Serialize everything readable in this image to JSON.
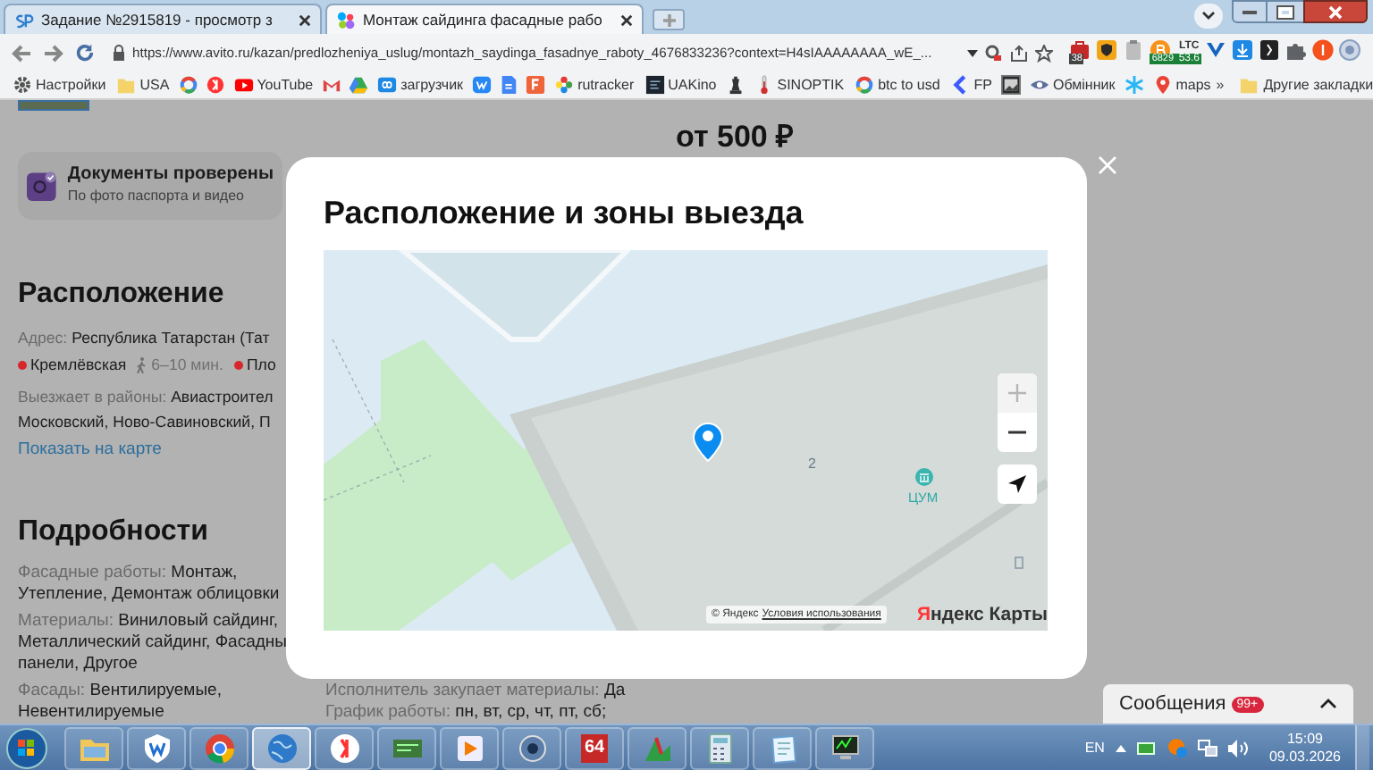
{
  "browser": {
    "tabs": [
      {
        "title": "Задание №2915819 - просмотр з",
        "kind": "sp",
        "selected": false
      },
      {
        "title": "Монтаж сайдинга фасадные рабо",
        "kind": "dots",
        "selected": true
      }
    ],
    "url": "https://www.avito.ru/kazan/predlozheniya_uslug/montazh_saydinga_fasadnye_raboty_4676833236?context=H4sIAAAAAAAA_wE_...",
    "extensions": [
      {
        "kind": "briefcase",
        "badge": "38"
      },
      {
        "kind": "shield"
      },
      {
        "kind": "clipboard"
      },
      {
        "kind": "coin",
        "badge": "6829"
      },
      {
        "kind": "ticker",
        "label": "LTC",
        "badge": "53.6"
      },
      {
        "kind": "v"
      },
      {
        "kind": "download"
      },
      {
        "kind": "dark"
      },
      {
        "kind": "puzzle"
      },
      {
        "kind": "avatar"
      },
      {
        "kind": "globe"
      }
    ],
    "bookmarks": [
      {
        "kind": "gear",
        "label": "Настройки"
      },
      {
        "kind": "folder",
        "label": "USA"
      },
      {
        "kind": "ring"
      },
      {
        "kind": "redcircle"
      },
      {
        "kind": "play",
        "label": "YouTube"
      },
      {
        "kind": "envelope"
      },
      {
        "kind": "triangle"
      },
      {
        "kind": "infinity",
        "label": "загрузчик"
      },
      {
        "kind": "bluesquare"
      },
      {
        "kind": "doc"
      },
      {
        "kind": "orangesquare"
      },
      {
        "kind": "flower",
        "label": "rutracker"
      },
      {
        "kind": "darksquare",
        "label": "UAKino"
      },
      {
        "kind": "chess"
      },
      {
        "kind": "thermometer",
        "label": "SINOPTIK"
      },
      {
        "kind": "ring",
        "label": "btc to usd"
      },
      {
        "kind": "chevron",
        "label": "FP"
      },
      {
        "kind": "image"
      },
      {
        "kind": "eye",
        "label": "Обмінник"
      },
      {
        "kind": "star"
      },
      {
        "kind": "pin",
        "label": "maps"
      }
    ],
    "bookmarks_overflow": "»",
    "other_bookmarks": "Другие закладки"
  },
  "page": {
    "price": "от 500 ₽",
    "verified": {
      "title": "Документы проверены",
      "subtitle": "По фото паспорта и видео"
    },
    "location": {
      "heading": "Расположение",
      "address": {
        "label": "Адрес:",
        "value": "Республика Татарстан (Тат"
      },
      "stations": [
        {
          "name": "Кремлёвская",
          "color": "#d7272d",
          "walk": "6–10 мин."
        },
        {
          "name": "Пло",
          "color": "#d7272d"
        }
      ],
      "districts": {
        "label": "Выезжает в районы:",
        "value": "Авиастроител",
        "continuation": "Московский, Ново-Савиновский, П"
      },
      "map_link": "Показать на карте"
    },
    "details": {
      "heading": "Подробности",
      "left": [
        {
          "label": "Фасадные работы:",
          "lines": [
            "Монтаж,",
            "Утепление, Демонтаж облицовки"
          ]
        },
        {
          "label": "Материалы:",
          "lines": [
            "Виниловый сайдинг,",
            "Металлический сайдинг, Фасадны",
            "панели, Другое"
          ]
        },
        {
          "label": "Фасады:",
          "lines": [
            "Вентилируемые,",
            "Невентилируемые"
          ]
        }
      ],
      "right": [
        {
          "label": "Исполнитель закупает материалы:",
          "lines": [
            "Да"
          ]
        },
        {
          "label": "График работы:",
          "lines": [
            "пн, вт, ср, чт, пт, сб;"
          ]
        }
      ]
    }
  },
  "modal": {
    "title": "Расположение и зоны выезда",
    "map": {
      "labels": [
        {
          "kind": "number",
          "text": "2"
        },
        {
          "kind": "poi",
          "text": "ЦУМ"
        }
      ],
      "attribution": "© Яндекс",
      "terms": "Условия использования",
      "logo": "Яндекс Карты",
      "zoom_in_disabled": true
    }
  },
  "messages": {
    "label": "Сообщения",
    "badge": "99+"
  },
  "taskbar": {
    "apps": [
      {
        "kind": "folder",
        "active": false
      },
      {
        "kind": "shield",
        "active": false
      },
      {
        "kind": "chrome",
        "active": false
      },
      {
        "kind": "globe",
        "active": true
      },
      {
        "kind": "yandex",
        "active": false
      },
      {
        "kind": "card",
        "active": false
      },
      {
        "kind": "media",
        "active": false
      },
      {
        "kind": "network",
        "active": false
      },
      {
        "kind": "number",
        "label": "64",
        "active": false
      },
      {
        "kind": "chart",
        "active": false
      },
      {
        "kind": "calculator",
        "active": false
      },
      {
        "kind": "notepad",
        "active": false
      },
      {
        "kind": "monitor",
        "active": false
      }
    ],
    "language": "EN",
    "time": "15:09",
    "date": "09.03.2026"
  }
}
